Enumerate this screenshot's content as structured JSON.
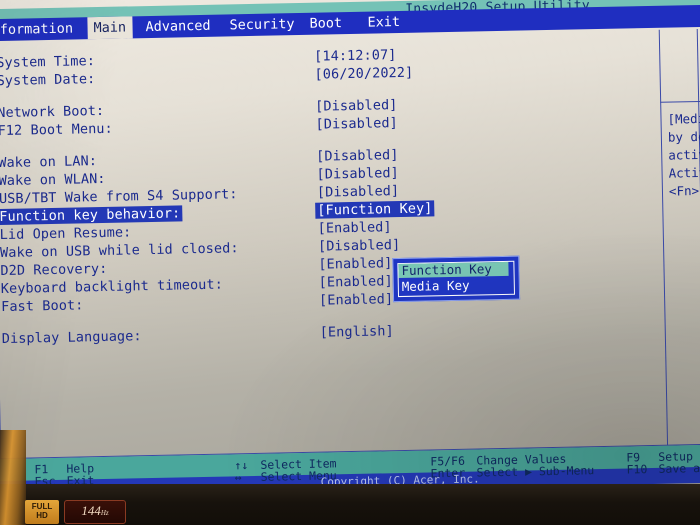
{
  "titlebar": {
    "utility_name": "InsydeH20 Setup Utility"
  },
  "menu": {
    "tabs": [
      {
        "label": "Information",
        "selected": false
      },
      {
        "label": "Main",
        "selected": true
      },
      {
        "label": "Advanced",
        "selected": false
      },
      {
        "label": "Security",
        "selected": false
      },
      {
        "label": "Boot",
        "selected": false
      },
      {
        "label": "Exit",
        "selected": false
      }
    ]
  },
  "settings": {
    "rows": [
      {
        "label": "System Time:",
        "value": "[14:12:07]",
        "selected": false
      },
      {
        "label": "System Date:",
        "value": "[06/20/2022]",
        "selected": false
      },
      {
        "label": "Network Boot:",
        "value": "[Disabled]",
        "selected": false
      },
      {
        "label": "F12 Boot Menu:",
        "value": "[Disabled]",
        "selected": false
      },
      {
        "label": "Wake on LAN:",
        "value": "[Disabled]",
        "selected": false
      },
      {
        "label": "Wake on WLAN:",
        "value": "[Disabled]",
        "selected": false
      },
      {
        "label": "USB/TBT Wake from S4 Support:",
        "value": "[Disabled]",
        "selected": false
      },
      {
        "label": "Function key behavior:",
        "value": "[Function Key]",
        "selected": true
      },
      {
        "label": "Lid Open Resume:",
        "value": "[Enabled]",
        "selected": false
      },
      {
        "label": "Wake on USB while lid closed:",
        "value": "[Disabled]",
        "selected": false
      },
      {
        "label": "D2D Recovery:",
        "value": "[Enabled]",
        "selected": false
      },
      {
        "label": "Keyboard backlight timeout:",
        "value": "[Enabled]",
        "selected": false
      },
      {
        "label": "Fast Boot:",
        "value": "[Enabled]",
        "selected": false
      },
      {
        "label": "Display Language:",
        "value": "[English]",
        "selected": false
      }
    ]
  },
  "help": {
    "lines": [
      "[Medi",
      "by de",
      "activa",
      "Activa",
      "<Fn> ke"
    ]
  },
  "dropdown": {
    "options": [
      {
        "label": "Function Key",
        "selected": true
      },
      {
        "label": "Media Key",
        "selected": false
      }
    ]
  },
  "footer": {
    "keys": [
      {
        "key": "F1",
        "action": "Help"
      },
      {
        "key": "Esc",
        "action": "Exit"
      },
      {
        "key": "↑↓",
        "action": "Select Item"
      },
      {
        "key": "↔",
        "action": "Select Menu"
      },
      {
        "key": "F5/F6",
        "action": "Change Values"
      },
      {
        "key": "Enter",
        "action": "Select ▶ Sub-Menu"
      },
      {
        "key": "F9",
        "action": "Setup De"
      },
      {
        "key": "F10",
        "action": "Save and"
      }
    ],
    "copyright": "Copyright (C) Acer, Inc."
  },
  "bezel": {
    "sticker_fullhd": "FULL HD",
    "sticker_refresh": "144",
    "sticker_refresh_unit": "Hz"
  },
  "colors": {
    "menubar_blue": "#1f2ec0",
    "titlebar_teal": "#74c2b6",
    "text_blue": "#1b2a8e",
    "highlight_blue": "#2338b6",
    "popup_sel_teal": "#79c7b4",
    "screen_bg": "#ddd8ce"
  }
}
